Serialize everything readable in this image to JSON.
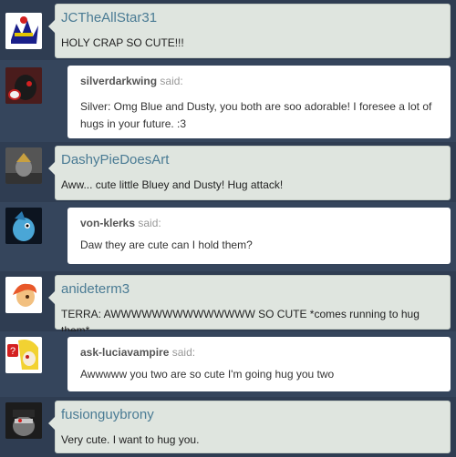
{
  "posts": [
    {
      "type": "comment",
      "username": "JCTheAllStar31",
      "text": "HOLY CRAP SO CUTE!!!"
    },
    {
      "type": "reply",
      "username": "silverdarkwing",
      "said": "said:",
      "text": "Silver: Omg Blue and Dusty, you both are soo adorable! I foresee a lot of hugs in your future. :3"
    },
    {
      "type": "comment",
      "username": "DashyPieDoesArt",
      "text": "Aww... cute little Bluey and Dusty! Hug attack!"
    },
    {
      "type": "reply",
      "username": "von-klerks",
      "said": "said:",
      "text": "Daw they are cute can I hold them?"
    },
    {
      "type": "comment",
      "username": "anideterm3",
      "text": "TERRA: AWWWWWWWWWWWWWW SO CUTE *comes running to hug them*"
    },
    {
      "type": "reply",
      "username": "ask-luciavampire",
      "said": "said:",
      "text": "Awwwww you two are so cute I'm going hug you two"
    },
    {
      "type": "comment",
      "username": "fusionguybrony",
      "text": "Very cute. I want to hug you."
    }
  ]
}
